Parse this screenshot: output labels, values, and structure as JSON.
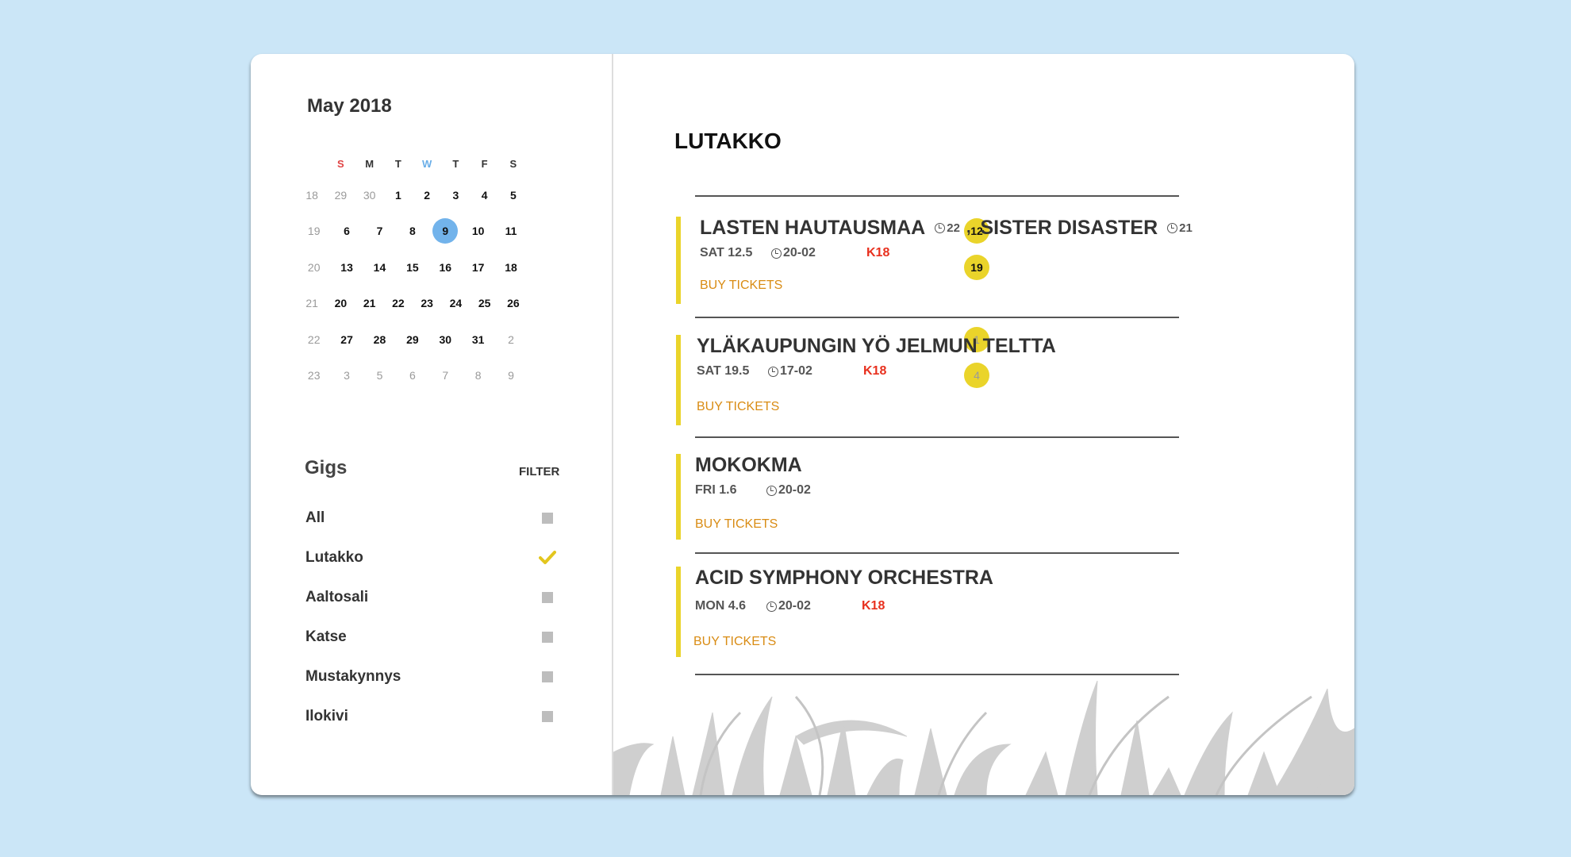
{
  "calendar": {
    "title": "May 2018",
    "weekdays": [
      "S",
      "M",
      "T",
      "W",
      "T",
      "F",
      "S"
    ],
    "weeks": [
      {
        "week": "18",
        "days": [
          "29",
          "30",
          "1",
          "2",
          "3",
          "4",
          "5"
        ]
      },
      {
        "week": "19",
        "days": [
          "6",
          "7",
          "8",
          "9",
          "10",
          "11",
          "12"
        ]
      },
      {
        "week": "20",
        "days": [
          "13",
          "14",
          "15",
          "16",
          "17",
          "18",
          "19"
        ]
      },
      {
        "week": "21",
        "days": [
          "20",
          "21",
          "22",
          "23",
          "24",
          "25",
          "26"
        ]
      },
      {
        "week": "22",
        "days": [
          "27",
          "28",
          "29",
          "30",
          "31",
          "1",
          "2"
        ]
      },
      {
        "week": "23",
        "days": [
          "3",
          "4",
          "5",
          "6",
          "7",
          "8",
          "9"
        ]
      }
    ],
    "colors": {
      "event": "#ead42a",
      "today": "#72b3eb",
      "sunday": "#e04444",
      "wednesday": "#6aaee8"
    }
  },
  "gigs": {
    "title": "Gigs",
    "filter_label": "FILTER",
    "items": [
      {
        "name": "All",
        "checked": false
      },
      {
        "name": "Lutakko",
        "checked": true
      },
      {
        "name": "Aaltosali",
        "checked": false
      },
      {
        "name": "Katse",
        "checked": false
      },
      {
        "name": "Mustakynnys",
        "checked": false
      },
      {
        "name": "Ilokivi",
        "checked": false
      }
    ]
  },
  "main": {
    "venue": "LUTAKKO",
    "events": [
      {
        "artist1": "LASTEN HAUTAUSMAA",
        "age1": "22",
        "comma": ",",
        "artist2": "SISTER DISASTER",
        "age2": "21",
        "date": "SAT 12.5",
        "time": "20-02",
        "rating": "K18",
        "buy": "BUY TICKETS"
      },
      {
        "title": "YLÄKAUPUNGIN YÖ JELMUN TELTTA",
        "date": "SAT 19.5",
        "time": "17-02",
        "rating": "K18",
        "buy": "BUY TICKETS"
      },
      {
        "title": "MOKOKMA",
        "date": "FRI 1.6",
        "time": "20-02",
        "buy": "BUY TICKETS"
      },
      {
        "title": "ACID SYMPHONY ORCHESTRA",
        "date": "MON 4.6",
        "time": "20-02",
        "rating": "K18",
        "buy": "BUY TICKETS"
      }
    ],
    "colors": {
      "accent": "#ead42a",
      "buy": "#d98c14",
      "rating": "#e8301e"
    }
  }
}
